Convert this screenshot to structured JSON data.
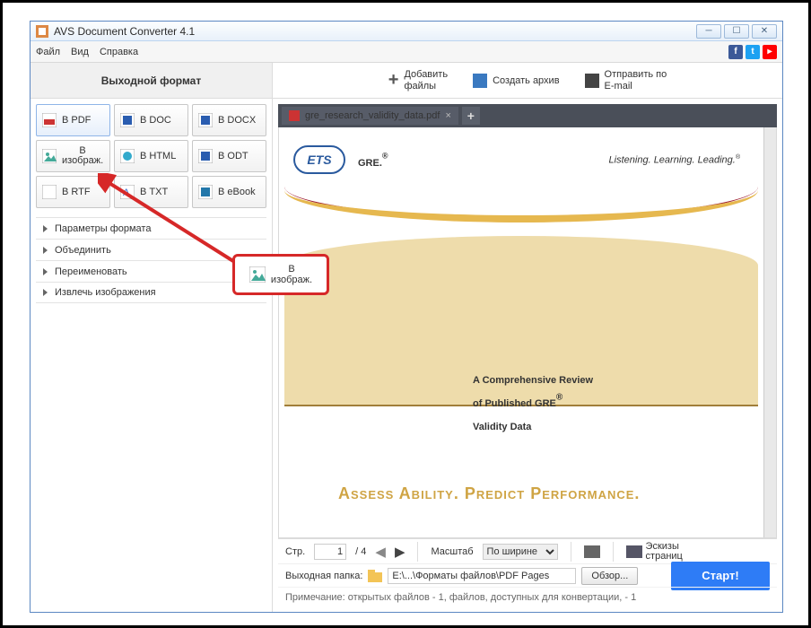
{
  "window": {
    "title": "AVS Document Converter 4.1"
  },
  "menu": {
    "file": "Файл",
    "view": "Вид",
    "help": "Справка"
  },
  "toolbar": {
    "output_format": "Выходной формат",
    "add_files": "Добавить\nфайлы",
    "archive": "Создать архив",
    "send_email": "Отправить по\nE-mail"
  },
  "formats": {
    "pdf": "В PDF",
    "doc": "В DOC",
    "docx": "В DOCX",
    "img_l1": "В",
    "img_l2": "изображ.",
    "html": "В HTML",
    "odt": "В ODT",
    "rtf": "В RTF",
    "txt": "В TXT",
    "ebook": "В eBook"
  },
  "options": {
    "params": "Параметры формата",
    "merge": "Объединить",
    "rename": "Переименовать",
    "extract": "Извлечь изображения"
  },
  "tab": {
    "name": "gre_research_validity_data.pdf"
  },
  "doc": {
    "ets": "ETS",
    "gre": "GRE.",
    "reg": "®",
    "tag": "Listening. Learning. Leading.",
    "reg2": "®",
    "t1": "A Comprehensive Review",
    "t2": "of Published GRE",
    "t3": "Validity Data",
    "assess": "Assess Ability. Predict Performance."
  },
  "nav": {
    "page_label": "Стр.",
    "page": "1",
    "total": "/ 4",
    "zoom_label": "Масштаб",
    "zoom": "По ширине",
    "thumbs": "Эскизы\nстраниц"
  },
  "output": {
    "label": "Выходная папка:",
    "path": "E:\\...\\Форматы файлов\\PDF Pages",
    "browse": "Обзор...",
    "start": "Старт!"
  },
  "note": "Примечание: открытых файлов - 1, файлов, доступных для конвертации, - 1",
  "callout": {
    "l1": "В",
    "l2": "изображ."
  }
}
